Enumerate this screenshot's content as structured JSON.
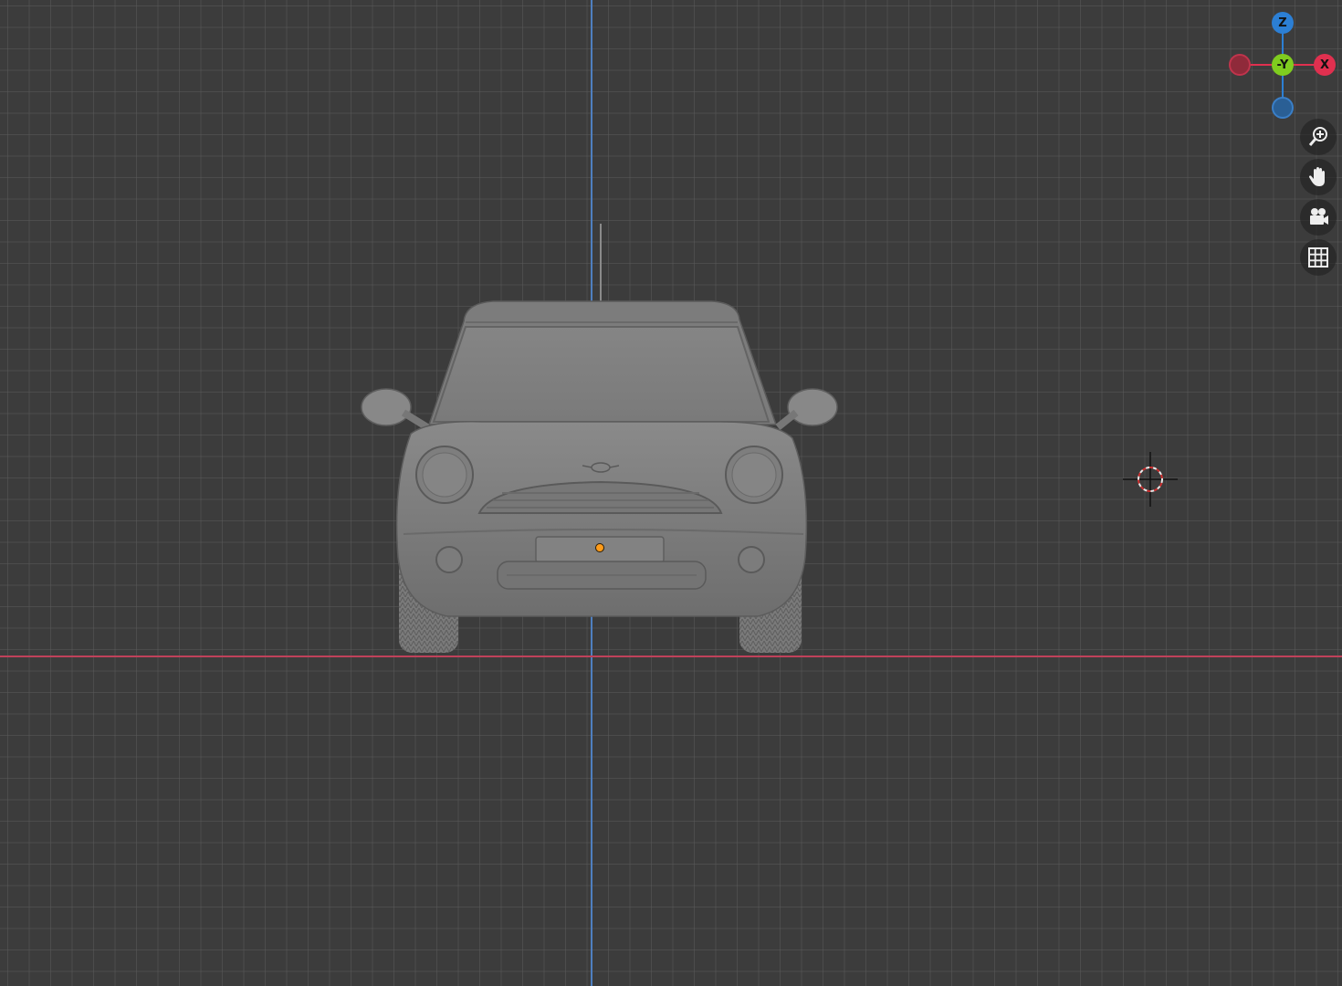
{
  "viewport": {
    "background": "#3c3c3c",
    "grid_color": "#5a5a5a",
    "x_axis_color": "#c0415a",
    "z_axis_color": "#4f7fc0",
    "object": "car-model",
    "origin_color": "#ff9c1a"
  },
  "gizmo": {
    "z_label": "Z",
    "y_label": "-Y",
    "x_label": "X",
    "z_color": "#2c7fd4",
    "y_color": "#7fcc1f",
    "x_color": "#e0304f"
  },
  "nav_buttons": [
    {
      "icon": "zoom-icon"
    },
    {
      "icon": "hand-pan-icon"
    },
    {
      "icon": "camera-icon"
    },
    {
      "icon": "grid-perspective-icon"
    }
  ]
}
